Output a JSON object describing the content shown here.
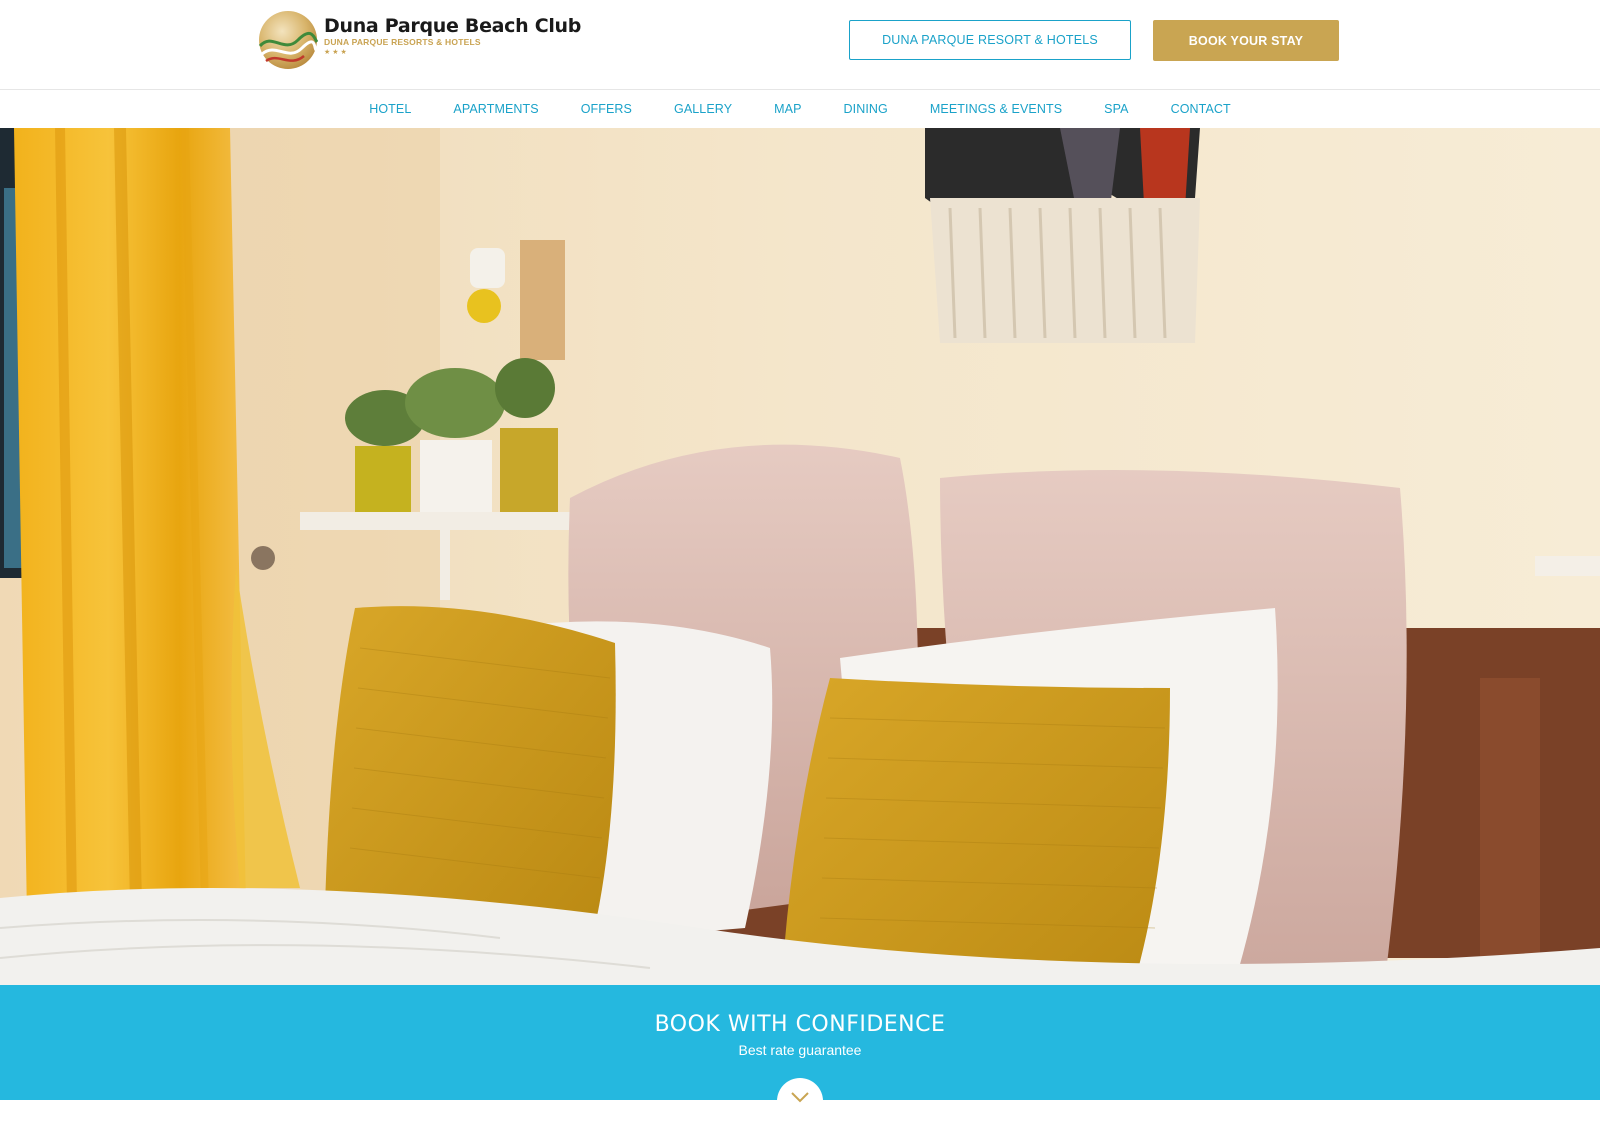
{
  "brand": {
    "title": "Duna Parque Beach Club",
    "subtitle": "DUNA PARQUE RESORTS & HOTELS",
    "stars": "★★★"
  },
  "header": {
    "group_button": "DUNA PARQUE RESORT & HOTELS",
    "book_button": "BOOK YOUR STAY"
  },
  "nav": {
    "items": [
      "HOTEL",
      "APARTMENTS",
      "OFFERS",
      "GALLERY",
      "MAP",
      "DINING",
      "MEETINGS & EVENTS",
      "SPA",
      "CONTACT"
    ]
  },
  "banner": {
    "title": "BOOK WITH CONFIDENCE",
    "subtitle": "Best rate guarantee"
  },
  "colors": {
    "accent_blue": "#1aa2c9",
    "gold": "#c9a552",
    "banner_blue": "#16b4de"
  },
  "icons": {
    "scroll": "chevron-down-icon"
  }
}
